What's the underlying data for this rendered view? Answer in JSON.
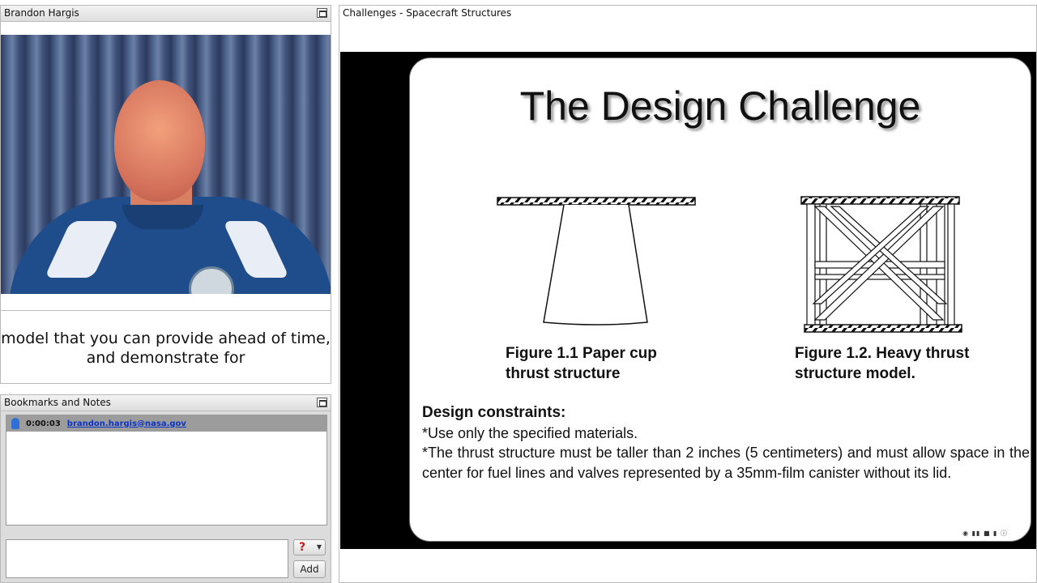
{
  "video_panel": {
    "title": "Brandon Hargis",
    "caption": "model that you can provide ahead of time, and demonstrate for"
  },
  "bookmarks_panel": {
    "title": "Bookmarks and Notes",
    "items": [
      {
        "time": "0:00:03",
        "author": "brandon.hargis@nasa.gov"
      }
    ],
    "note_value": "",
    "help_label": "?",
    "add_label": "Add"
  },
  "slide_panel": {
    "title": "Challenges - Spacecraft Structures"
  },
  "slide": {
    "title": "The Design Challenge",
    "figure1_caption": "Figure 1.1 Paper cup thrust structure",
    "figure2_caption": "Figure 1.2.  Heavy thrust structure model.",
    "constraints_heading": "Design constraints:",
    "constraint_1": "*Use only the specified materials.",
    "constraint_2": "*The thrust structure must be taller than 2 inches (5 centimeters) and must allow space in the center for fuel lines and valves represented by a 35mm-film canister without its lid."
  },
  "icons": [
    "maximize-icon",
    "bookmark-icon",
    "help-icon",
    "player-controls-icon"
  ]
}
